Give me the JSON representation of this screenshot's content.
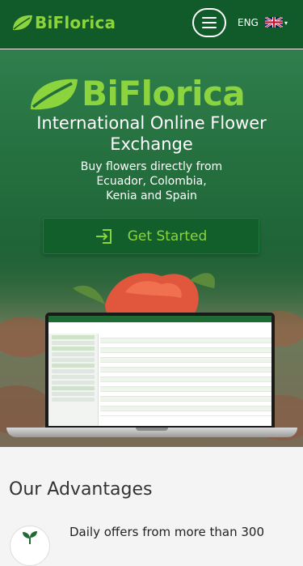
{
  "header": {
    "brand": "BiFlorica",
    "language": "ENG",
    "flag_icon": "uk-flag-icon",
    "menu_icon": "hamburger-icon"
  },
  "hero": {
    "brand": "BiFlorica",
    "title": "International Online Flower Exchange",
    "title_line1": "International Online Flower",
    "title_line2": "Exchange",
    "subtitle_line1": "Buy flowers directly from",
    "subtitle_line2": "Ecuador, Colombia,",
    "subtitle_line3": "Kenia and Spain",
    "cta_label": "Get Started",
    "cta_icon": "login-icon"
  },
  "advantages": {
    "title": "Our Advantages",
    "items": [
      {
        "icon": "sprout-icon",
        "text": "Daily offers from more than 300"
      }
    ]
  },
  "colors": {
    "brand_green": "#8bd43e",
    "header_bg": "#115a2a",
    "cta_bg": "#125f2b"
  }
}
